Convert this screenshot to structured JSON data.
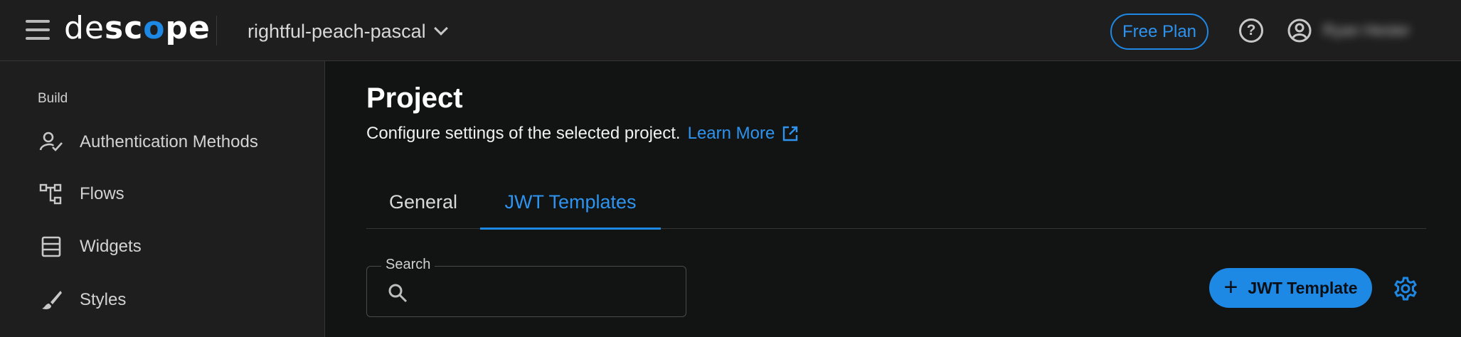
{
  "header": {
    "logo": {
      "part1": "de",
      "part2": "sc",
      "part3": "o",
      "part4": "pe"
    },
    "project_name": "rightful-peach-pascal",
    "plan_label": "Free Plan",
    "help_icon": "help-circle-icon",
    "account_icon": "account-circle-icon",
    "username": "Ryan Hester"
  },
  "sidebar": {
    "section_label": "Build",
    "items": [
      {
        "label": "Authentication Methods",
        "icon": "user-check-icon"
      },
      {
        "label": "Flows",
        "icon": "flow-icon"
      },
      {
        "label": "Widgets",
        "icon": "widgets-icon"
      },
      {
        "label": "Styles",
        "icon": "brush-icon"
      }
    ]
  },
  "main": {
    "title": "Project",
    "subtitle": "Configure settings of the selected project.",
    "learn_more": "Learn More",
    "tabs": [
      {
        "label": "General",
        "active": false
      },
      {
        "label": "JWT Templates",
        "active": true
      }
    ],
    "search": {
      "label": "Search",
      "value": "",
      "placeholder": ""
    },
    "add_button_label": "JWT Template",
    "settings_icon": "gear-icon"
  },
  "colors": {
    "accent": "#1e88e5",
    "background": "#121414",
    "panel": "#1e1e1e"
  }
}
